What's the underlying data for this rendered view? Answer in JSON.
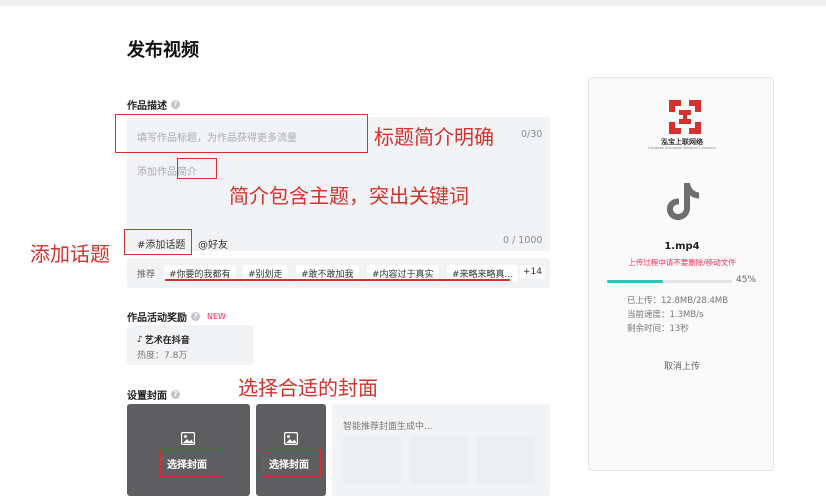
{
  "page": {
    "title": "发布视频"
  },
  "description": {
    "label": "作品描述",
    "title_placeholder": "填写作品标题，为作品获得更多流量",
    "title_counter": "0/30",
    "body_placeholder": "添加作品简介",
    "topic_button": "#添加话题",
    "friend_button": "@好友",
    "body_counter": "0 / 1000"
  },
  "recommend": {
    "label": "推荐",
    "chips": [
      "#你要的我都有",
      "#别划走",
      "#敢不敢加我",
      "#内容过于真实",
      "#来略来略真..."
    ],
    "more": "+14"
  },
  "activity": {
    "label": "作品活动奖励",
    "badge": "NEW",
    "card_title": "艺术在抖音",
    "card_heat": "热度：7.8万"
  },
  "cover": {
    "label": "设置封面",
    "choose_1": "选择封面",
    "choose_2": "选择封面",
    "smart_text": "智能推荐封面生成中..."
  },
  "annotations": {
    "title": "标题简介明确",
    "summary": "简介包含主题，突出关键词",
    "topic": "添加话题",
    "cover": "选择合适的封面"
  },
  "upload": {
    "logo_text": "泓宝上联网络",
    "logo_sub": "Hongbao Shanglian Network Company",
    "filename": "1.mp4",
    "warning": "上传过程中请不要删除/移动文件",
    "progress": 0.45,
    "progress_text": "45%",
    "uploaded": "已上传：12.8MB/28.4MB",
    "speed": "当前速度：1.3MB/s",
    "remaining": "剩余时间：13秒",
    "cancel": "取消上传"
  },
  "colors": {
    "accent_red": "#d5312f",
    "progress_teal": "#2ec4b6"
  }
}
